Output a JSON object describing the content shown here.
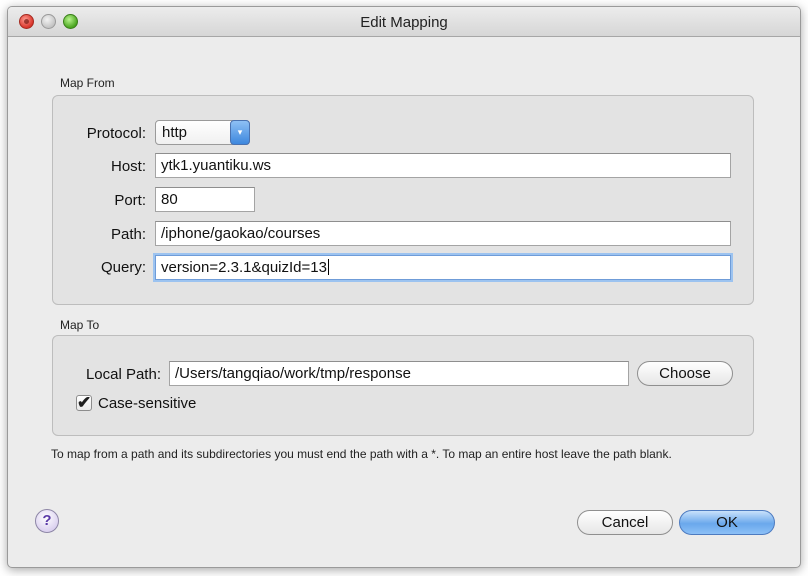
{
  "window": {
    "title": "Edit Mapping"
  },
  "map_from": {
    "label": "Map From",
    "protocol": {
      "label": "Protocol:",
      "value": "http",
      "arrows_icon": "updown-arrows-icon"
    },
    "host": {
      "label": "Host:",
      "value": "ytk1.yuantiku.ws"
    },
    "port": {
      "label": "Port:",
      "value": "80"
    },
    "path": {
      "label": "Path:",
      "value": "/iphone/gaokao/courses"
    },
    "query": {
      "label": "Query:",
      "value": "version=2.3.1&quizId=13"
    }
  },
  "map_to": {
    "label": "Map To",
    "local_path": {
      "label": "Local Path:",
      "value": "/Users/tangqiao/work/tmp/response"
    },
    "choose_label": "Choose",
    "case_sensitive": {
      "label": "Case-sensitive",
      "checked": true,
      "check_glyph": "✔"
    }
  },
  "hint": "To map from a path and its subdirectories you must end the path with a *. To map an entire host leave the path blank.",
  "footer": {
    "help_label": "?",
    "cancel_label": "Cancel",
    "ok_label": "OK"
  },
  "colors": {
    "accent_blue": "#6aa8ec",
    "focus_ring": "#9cc3f0",
    "close_red": "#d8352b",
    "maximize_green": "#4aa51f"
  }
}
